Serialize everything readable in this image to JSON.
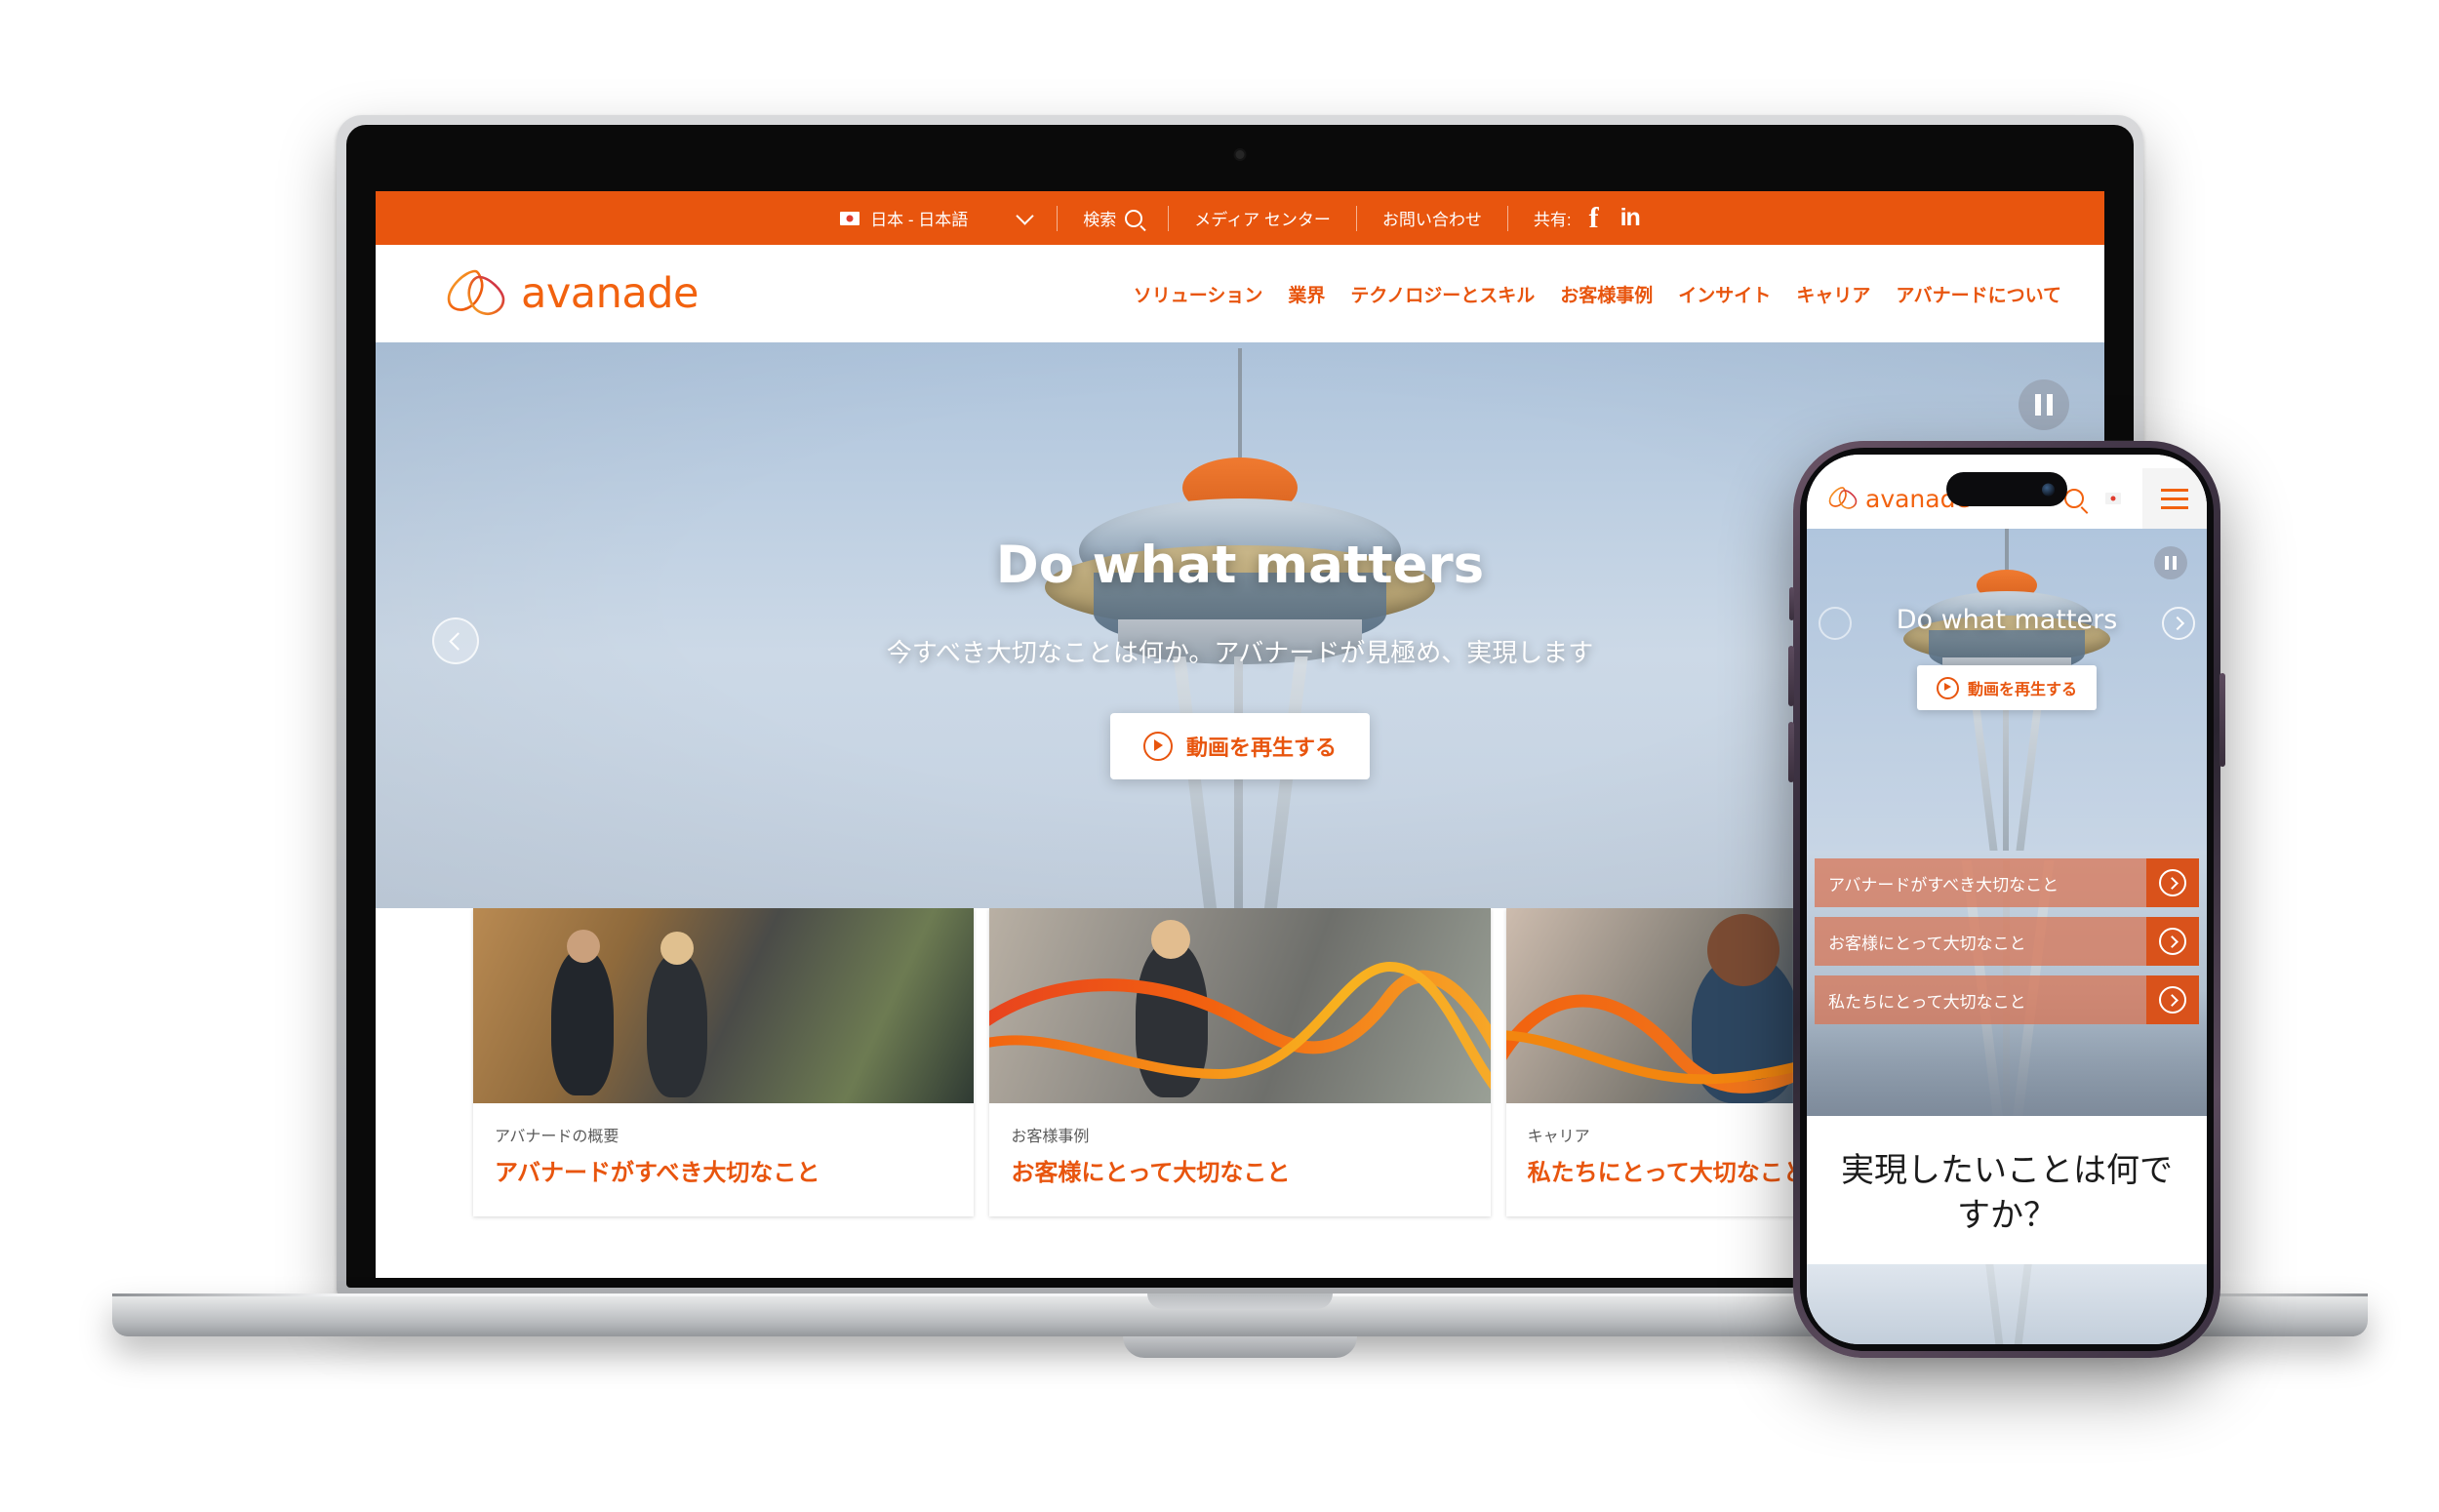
{
  "site": {
    "brand_name": "avanade",
    "brand_color": "#f2620f",
    "utility_bar": {
      "bg_color": "#e8550e",
      "locale_label": "日本 - 日本語",
      "locale_flag_icon": "japan-flag-icon",
      "locale_chevron_icon": "chevron-down-icon",
      "search_label": "検索",
      "search_icon": "search-icon",
      "media_center_label": "メディア センター",
      "contact_label": "お問い合わせ",
      "share_label": "共有:",
      "facebook_icon": "facebook-icon",
      "facebook_glyph": "f",
      "linkedin_icon": "linkedin-icon",
      "linkedin_glyph": "in"
    },
    "nav_items": [
      {
        "label": "ソリューション"
      },
      {
        "label": "業界"
      },
      {
        "label": "テクノロジーとスキル"
      },
      {
        "label": "お客様事例"
      },
      {
        "label": "インサイト"
      },
      {
        "label": "キャリア"
      },
      {
        "label": "アバナードについて"
      }
    ],
    "hero": {
      "title": "Do what matters",
      "subtitle": "今すべき大切なことは何か。アバナードが見極め、実現します",
      "cta_label": "動画を再生する",
      "cta_icon": "play-circle-icon",
      "pause_icon": "pause-icon",
      "prev_icon": "chevron-left-icon",
      "next_icon": "chevron-right-icon"
    },
    "cards": [
      {
        "kicker": "アバナードの概要",
        "title": "アバナードがすべき大切なこと"
      },
      {
        "kicker": "お客様事例",
        "title": "お客様にとって大切なこと"
      },
      {
        "kicker": "キャリア",
        "title": "私たちにとって大切なこと"
      }
    ]
  },
  "phone": {
    "brand_name": "avanade",
    "search_icon": "search-icon",
    "locale_flag_icon": "japan-flag-icon",
    "menu_icon": "hamburger-menu-icon",
    "hero": {
      "title": "Do what matters",
      "cta_label": "動画を再生する",
      "cta_icon": "play-circle-icon",
      "pause_icon": "pause-icon",
      "prev_icon": "chevron-left-icon",
      "next_icon": "chevron-right-icon"
    },
    "accordion": [
      {
        "label": "アバナードがすべき大切なこと",
        "go_icon": "chevron-right-circle-icon"
      },
      {
        "label": "お客様にとって大切なこと",
        "go_icon": "chevron-right-circle-icon"
      },
      {
        "label": "私たちにとって大切なこと",
        "go_icon": "chevron-right-circle-icon"
      }
    ],
    "question": "実現したいことは何ですか？"
  }
}
